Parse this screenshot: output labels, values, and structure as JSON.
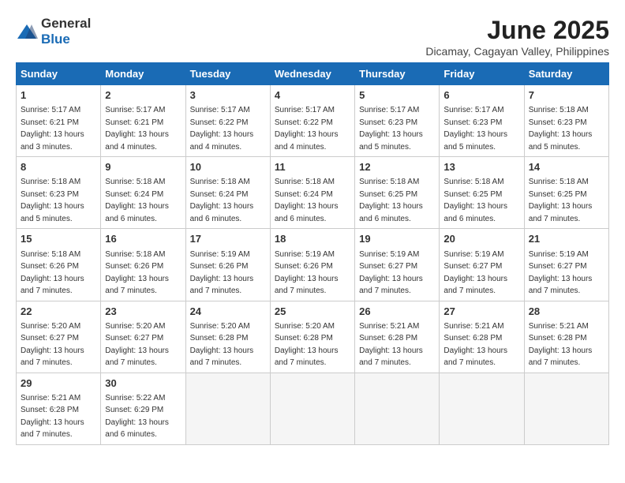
{
  "logo": {
    "general": "General",
    "blue": "Blue"
  },
  "title": {
    "month_year": "June 2025",
    "location": "Dicamay, Cagayan Valley, Philippines"
  },
  "headers": [
    "Sunday",
    "Monday",
    "Tuesday",
    "Wednesday",
    "Thursday",
    "Friday",
    "Saturday"
  ],
  "weeks": [
    [
      {
        "day": "1",
        "sunrise": "5:17 AM",
        "sunset": "6:21 PM",
        "daylight": "13 hours and 3 minutes."
      },
      {
        "day": "2",
        "sunrise": "5:17 AM",
        "sunset": "6:21 PM",
        "daylight": "13 hours and 4 minutes."
      },
      {
        "day": "3",
        "sunrise": "5:17 AM",
        "sunset": "6:22 PM",
        "daylight": "13 hours and 4 minutes."
      },
      {
        "day": "4",
        "sunrise": "5:17 AM",
        "sunset": "6:22 PM",
        "daylight": "13 hours and 4 minutes."
      },
      {
        "day": "5",
        "sunrise": "5:17 AM",
        "sunset": "6:23 PM",
        "daylight": "13 hours and 5 minutes."
      },
      {
        "day": "6",
        "sunrise": "5:17 AM",
        "sunset": "6:23 PM",
        "daylight": "13 hours and 5 minutes."
      },
      {
        "day": "7",
        "sunrise": "5:18 AM",
        "sunset": "6:23 PM",
        "daylight": "13 hours and 5 minutes."
      }
    ],
    [
      {
        "day": "8",
        "sunrise": "5:18 AM",
        "sunset": "6:23 PM",
        "daylight": "13 hours and 5 minutes."
      },
      {
        "day": "9",
        "sunrise": "5:18 AM",
        "sunset": "6:24 PM",
        "daylight": "13 hours and 6 minutes."
      },
      {
        "day": "10",
        "sunrise": "5:18 AM",
        "sunset": "6:24 PM",
        "daylight": "13 hours and 6 minutes."
      },
      {
        "day": "11",
        "sunrise": "5:18 AM",
        "sunset": "6:24 PM",
        "daylight": "13 hours and 6 minutes."
      },
      {
        "day": "12",
        "sunrise": "5:18 AM",
        "sunset": "6:25 PM",
        "daylight": "13 hours and 6 minutes."
      },
      {
        "day": "13",
        "sunrise": "5:18 AM",
        "sunset": "6:25 PM",
        "daylight": "13 hours and 6 minutes."
      },
      {
        "day": "14",
        "sunrise": "5:18 AM",
        "sunset": "6:25 PM",
        "daylight": "13 hours and 7 minutes."
      }
    ],
    [
      {
        "day": "15",
        "sunrise": "5:18 AM",
        "sunset": "6:26 PM",
        "daylight": "13 hours and 7 minutes."
      },
      {
        "day": "16",
        "sunrise": "5:18 AM",
        "sunset": "6:26 PM",
        "daylight": "13 hours and 7 minutes."
      },
      {
        "day": "17",
        "sunrise": "5:19 AM",
        "sunset": "6:26 PM",
        "daylight": "13 hours and 7 minutes."
      },
      {
        "day": "18",
        "sunrise": "5:19 AM",
        "sunset": "6:26 PM",
        "daylight": "13 hours and 7 minutes."
      },
      {
        "day": "19",
        "sunrise": "5:19 AM",
        "sunset": "6:27 PM",
        "daylight": "13 hours and 7 minutes."
      },
      {
        "day": "20",
        "sunrise": "5:19 AM",
        "sunset": "6:27 PM",
        "daylight": "13 hours and 7 minutes."
      },
      {
        "day": "21",
        "sunrise": "5:19 AM",
        "sunset": "6:27 PM",
        "daylight": "13 hours and 7 minutes."
      }
    ],
    [
      {
        "day": "22",
        "sunrise": "5:20 AM",
        "sunset": "6:27 PM",
        "daylight": "13 hours and 7 minutes."
      },
      {
        "day": "23",
        "sunrise": "5:20 AM",
        "sunset": "6:27 PM",
        "daylight": "13 hours and 7 minutes."
      },
      {
        "day": "24",
        "sunrise": "5:20 AM",
        "sunset": "6:28 PM",
        "daylight": "13 hours and 7 minutes."
      },
      {
        "day": "25",
        "sunrise": "5:20 AM",
        "sunset": "6:28 PM",
        "daylight": "13 hours and 7 minutes."
      },
      {
        "day": "26",
        "sunrise": "5:21 AM",
        "sunset": "6:28 PM",
        "daylight": "13 hours and 7 minutes."
      },
      {
        "day": "27",
        "sunrise": "5:21 AM",
        "sunset": "6:28 PM",
        "daylight": "13 hours and 7 minutes."
      },
      {
        "day": "28",
        "sunrise": "5:21 AM",
        "sunset": "6:28 PM",
        "daylight": "13 hours and 7 minutes."
      }
    ],
    [
      {
        "day": "29",
        "sunrise": "5:21 AM",
        "sunset": "6:28 PM",
        "daylight": "13 hours and 7 minutes."
      },
      {
        "day": "30",
        "sunrise": "5:22 AM",
        "sunset": "6:29 PM",
        "daylight": "13 hours and 6 minutes."
      },
      null,
      null,
      null,
      null,
      null
    ]
  ]
}
